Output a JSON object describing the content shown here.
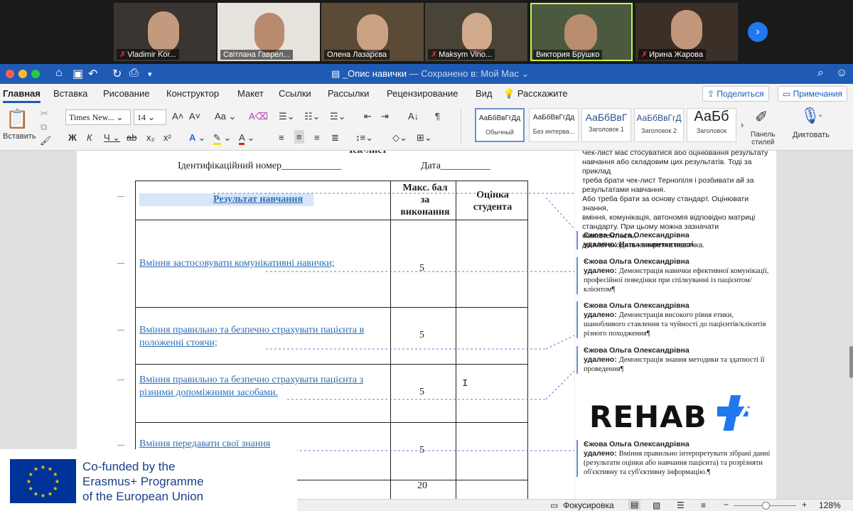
{
  "participants": [
    {
      "name": "Vladimir Kor...",
      "muted": true
    },
    {
      "name": "Світлана Гаврел...",
      "muted": false
    },
    {
      "name": "Олена Лазарєва",
      "muted": false
    },
    {
      "name": "Maksym Vino...",
      "muted": true
    },
    {
      "name": "Виктория Брушко",
      "muted": false,
      "active": true
    },
    {
      "name": "Ирина Жарова",
      "muted": true
    }
  ],
  "window": {
    "doc_title": "_Опис навички",
    "saved_status": "— Сохранено в: Мой Mac"
  },
  "ribbon_tabs": [
    "Главная",
    "Вставка",
    "Рисование",
    "Конструктор",
    "Макет",
    "Ссылки",
    "Рассылки",
    "Рецензирование",
    "Вид"
  ],
  "tell_me": "Расскажите",
  "share_label": "Поделиться",
  "comments_label": "Примечания",
  "toolbar": {
    "paste_label": "Вставить",
    "font_name": "Times New...",
    "font_size": "14",
    "styles": [
      {
        "sample": "АаБбВвГгДд",
        "label": "Обычный"
      },
      {
        "sample": "АаБбВвГгДд",
        "label": "Без интерва..."
      },
      {
        "sample": "АаБбВвГ",
        "label": "Заголовок 1"
      },
      {
        "sample": "АаБбВвГгД",
        "label": "Заголовок 2"
      },
      {
        "sample": "АаБб",
        "label": "Заголовок"
      }
    ],
    "styles_pane_label": "Панель\nстилей",
    "dictate_label": "Диктовать"
  },
  "document": {
    "partial_title": "Чек-лист",
    "id_label": "Ідентифікаційний номер____________",
    "date_label": "Дата__________",
    "headers": {
      "result": "Результат навчання",
      "max": [
        "Макс. бал",
        "за",
        "виконання"
      ],
      "grade": [
        "Оцінка",
        "студента"
      ]
    },
    "rows": [
      {
        "skill": [
          "Вміння застосовувати комунікативні навички;"
        ],
        "max": "5"
      },
      {
        "skill": [
          "Вміння правильно та безпечно страхувати пацієнта в",
          "положенні стоячи;"
        ],
        "max": "5"
      },
      {
        "skill": [
          "Вміння правильно та безпечно страхувати пацієнта з",
          "різними допоміжними засобами."
        ],
        "max": "5"
      },
      {
        "skill": [
          "Вміння передавати свої знання"
        ],
        "max": "5"
      }
    ],
    "total": "20"
  },
  "comments": {
    "intro": [
      "Чек-лист має стосуватися або оцінювання результату",
      "навчання або складовим цих результатів. Тоді за приклад",
      "треба брати чек-лист Тернопіля і розбивати ай за",
      "результатами навчання.",
      "Або треба брати за основу стандарт. Оцінювати знання,",
      "вміння, комунікація, автономія відповідно матриці",
      "стандарту. При цьому можна зазначати компетентність,",
      "до якої входить конкретна навичка."
    ],
    "deleted_label": "удалено:",
    "items": [
      {
        "author": "Єжова Ольга Олександрівна",
        "text": "Назва компетентності"
      },
      {
        "author": "Єжова Ольга Олександрівна",
        "text": "Демонстрація навички ефективної комунікації, професійної поведінки при спілкуванні із пацієнтом/клієнтом¶"
      },
      {
        "author": "Єжова Ольга Олександрівна",
        "text": "Демонстрація високого рівня етики, шанобливого ставлення та чуйності до пацієнтів/клієнтів різного походження¶"
      },
      {
        "author": "Єжова Ольга Олександрівна",
        "text": "Демонстрація знання методики та здатності її проведення¶"
      },
      {
        "author": "Єжова Ольга Олександрівна",
        "text": "Вміння правильно інтерпретувати зібрані данні (результати оцінки або навчання пацієнта) та розрізняти об'єктивну та суб'єктивну інформацію.¶"
      }
    ]
  },
  "logo_text": "REHAB",
  "status": {
    "focus_label": "Фокусировка",
    "zoom": "128%"
  },
  "eu_banner": [
    "Co-funded by the",
    "Erasmus+ Programme",
    "of the European Union"
  ],
  "colors": {
    "word_blue": "#1f5bb5",
    "link_blue": "#2d6fb5",
    "eu_blue": "#003399",
    "eu_star": "#ffcc00",
    "logo_accent": "#1f78f0"
  }
}
